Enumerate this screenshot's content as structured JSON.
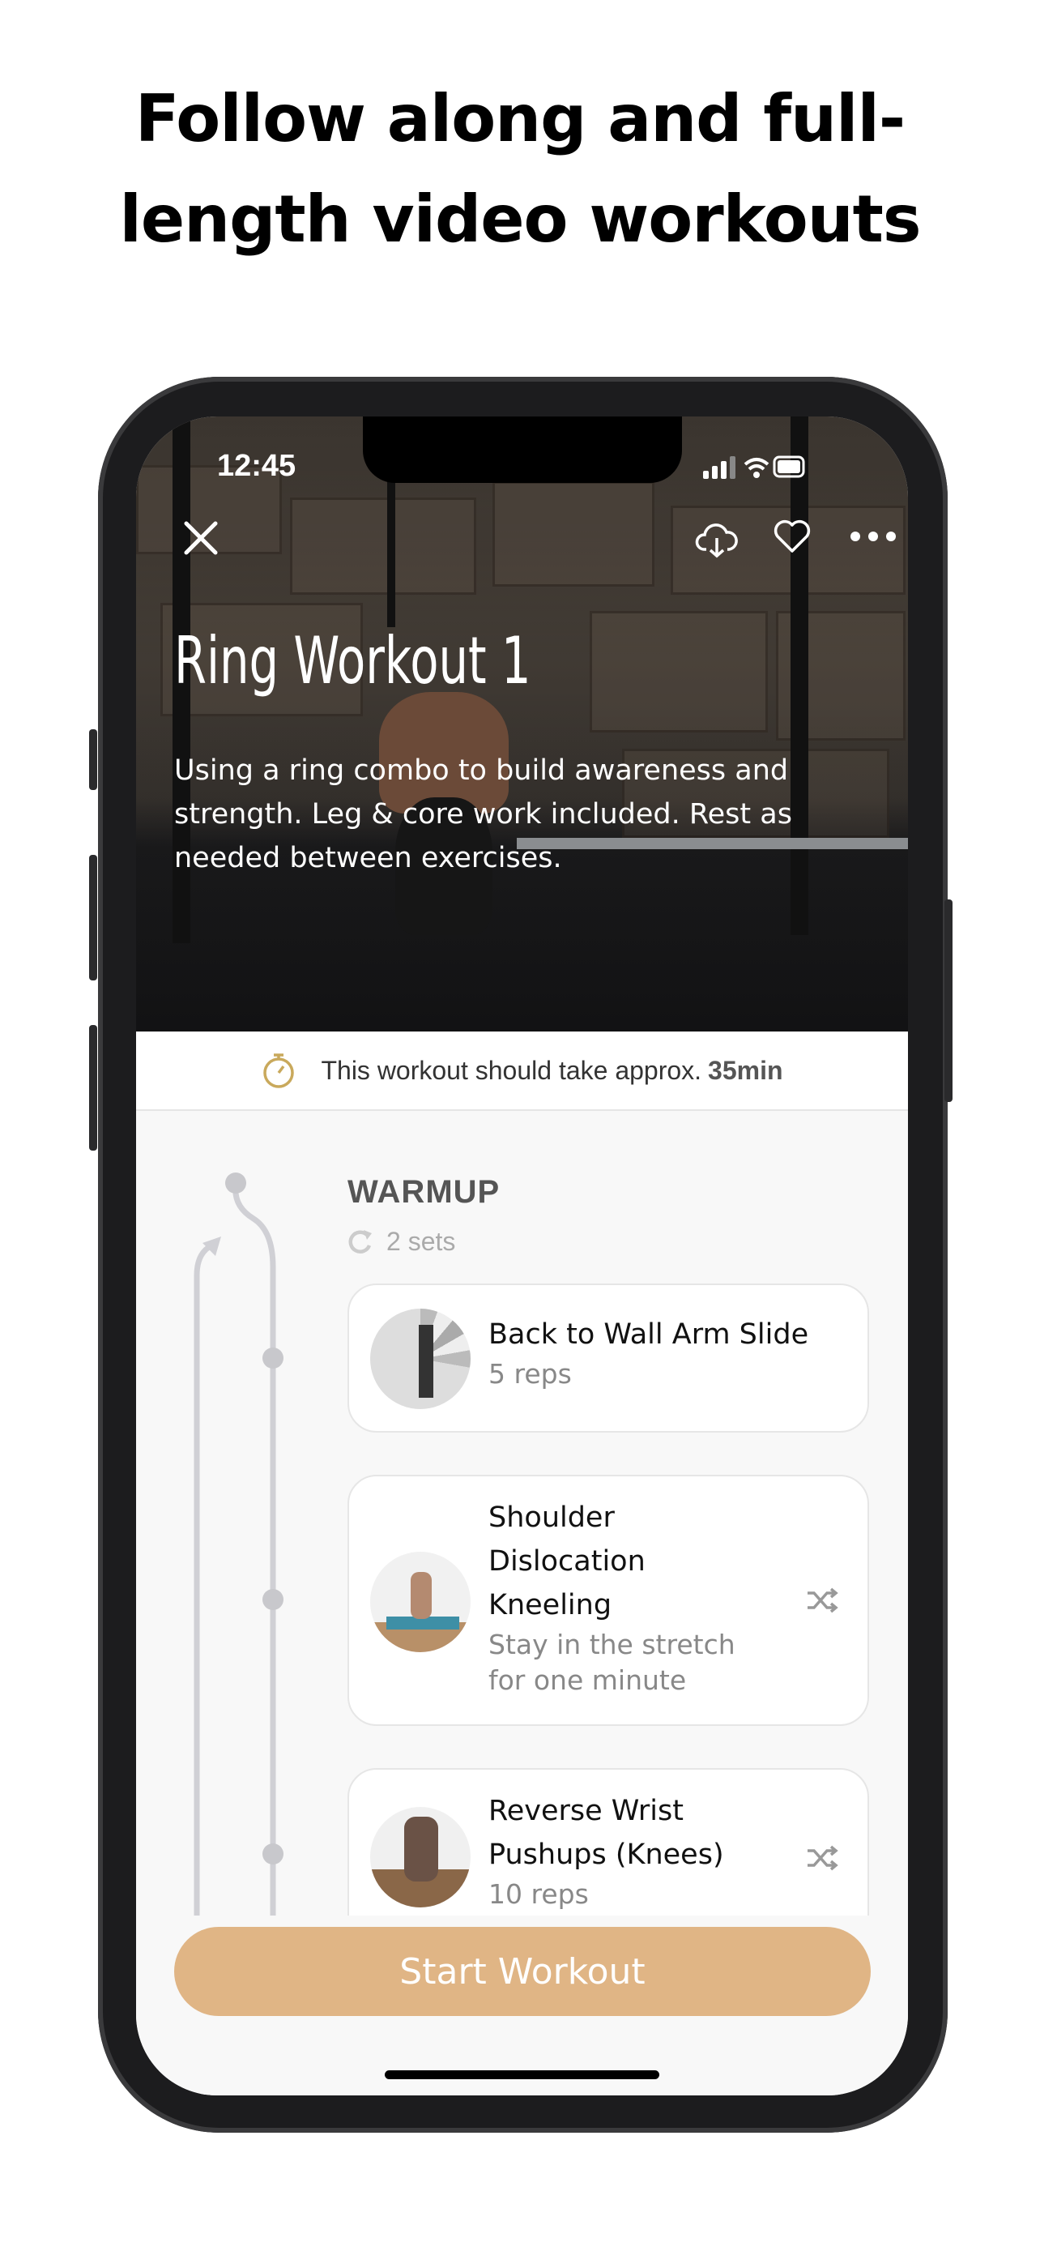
{
  "headline": {
    "line1": "Follow along and full-",
    "line2": "length video workouts"
  },
  "status_bar": {
    "time": "12:45"
  },
  "hero": {
    "title": "Ring Workout 1",
    "description": "Using a ring combo to build awareness and strength. Leg & core work included. Rest as needed between exercises.",
    "icons": [
      "close-icon",
      "cloud-download-icon",
      "heart-icon",
      "more-icon"
    ]
  },
  "duration": {
    "text": "This workout should take approx.",
    "value": "35min",
    "icon": "stopwatch-icon"
  },
  "section": {
    "title": "WARMUP",
    "sets": "2 sets"
  },
  "exercises": [
    {
      "name": "Back to Wall Arm Slide",
      "detail": "5 reps"
    },
    {
      "name": "Shoulder Dislocation Kneeling",
      "detail": "Stay in the stretch for one minute",
      "icon": "shuffle-icon"
    },
    {
      "name": "Reverse Wrist Pushups (Knees)",
      "detail": "10 reps",
      "icon": "shuffle-icon"
    }
  ],
  "start_button": {
    "label": "Start Workout"
  },
  "colors": {
    "accent": "#E0B585",
    "timeline": "#D0D0D5",
    "stopwatch": "#C9A95C"
  }
}
